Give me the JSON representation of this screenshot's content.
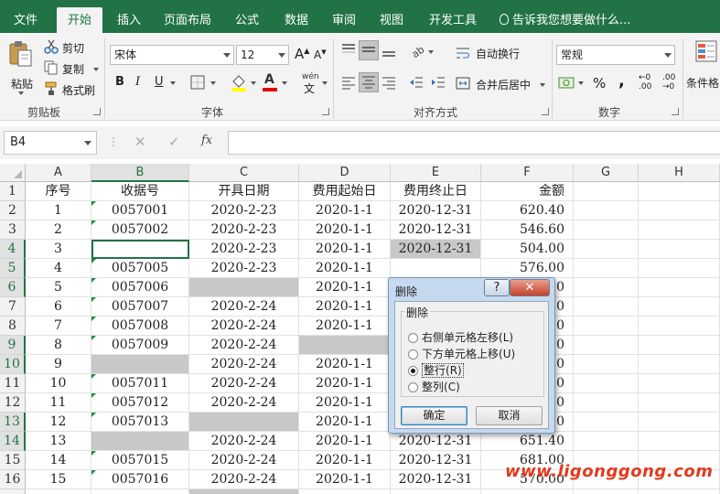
{
  "ribbon_tabs": [
    {
      "label": "文件"
    },
    {
      "label": "开始"
    },
    {
      "label": "插入"
    },
    {
      "label": "页面布局"
    },
    {
      "label": "公式"
    },
    {
      "label": "数据"
    },
    {
      "label": "审阅"
    },
    {
      "label": "视图"
    },
    {
      "label": "开发工具"
    }
  ],
  "active_tab": "开始",
  "tell_me": "告诉我您想要做什么...",
  "clipboard": {
    "paste": "粘贴",
    "cut": "剪切",
    "copy": "复制",
    "format_painter": "格式刷",
    "group_label": "剪贴板"
  },
  "font": {
    "name": "宋体",
    "size": "12",
    "grow": "A",
    "shrink": "A",
    "bold": "B",
    "italic": "I",
    "underline": "U",
    "wen": "wén",
    "group_label": "字体"
  },
  "alignment": {
    "wrap_text": "自动换行",
    "merge_center": "合并后居中",
    "group_label": "对齐方式"
  },
  "number": {
    "format": "常规",
    "percent": "%",
    "comma": ",",
    "inc_decimal": "←0 .00",
    "dec_decimal": ".00 →0",
    "group_label": "数字"
  },
  "styles": {
    "conditional_format": "条件格"
  },
  "formula_bar": {
    "name_box": "B4",
    "cancel": "✕",
    "enter": "✓",
    "fx": "fx",
    "content": ""
  },
  "columns": [
    "A",
    "B",
    "C",
    "D",
    "E",
    "F",
    "G",
    "H"
  ],
  "selected_column": "B",
  "rows": [
    {
      "n": "1",
      "a": "序号",
      "b": "收据号",
      "c": "开具日期",
      "d": "费用起始日",
      "e": "费用终止日",
      "f": "金额"
    },
    {
      "n": "2",
      "a": "1",
      "b": "0057001",
      "c": "2020-2-23",
      "d": "2020-1-1",
      "e": "2020-12-31",
      "f": "620.40"
    },
    {
      "n": "3",
      "a": "2",
      "b": "0057002",
      "c": "2020-2-23",
      "d": "2020-1-1",
      "e": "2020-12-31",
      "f": "546.60"
    },
    {
      "n": "4",
      "a": "3",
      "b": "",
      "c": "2020-2-23",
      "d": "2020-1-1",
      "e": "2020-12-31",
      "f": "504.00"
    },
    {
      "n": "5",
      "a": "4",
      "b": "0057005",
      "c": "2020-2-23",
      "d": "2020-1-1",
      "e": "",
      "f": "576.00"
    },
    {
      "n": "6",
      "a": "5",
      "b": "0057006",
      "c": "",
      "d": "2020-1-1",
      "e": "",
      "f": "0"
    },
    {
      "n": "7",
      "a": "6",
      "b": "0057007",
      "c": "2020-2-24",
      "d": "2020-1-1",
      "e": "",
      "f": "0"
    },
    {
      "n": "8",
      "a": "7",
      "b": "0057008",
      "c": "2020-2-24",
      "d": "2020-1-1",
      "e": "",
      "f": "0"
    },
    {
      "n": "9",
      "a": "8",
      "b": "0057009",
      "c": "2020-2-24",
      "d": "",
      "e": "",
      "f": "0"
    },
    {
      "n": "10",
      "a": "9",
      "b": "",
      "c": "2020-2-24",
      "d": "2020-1-1",
      "e": "",
      "f": "0"
    },
    {
      "n": "11",
      "a": "10",
      "b": "0057011",
      "c": "2020-2-24",
      "d": "2020-1-1",
      "e": "",
      "f": "0"
    },
    {
      "n": "12",
      "a": "11",
      "b": "0057012",
      "c": "2020-2-24",
      "d": "2020-1-1",
      "e": "",
      "f": "0"
    },
    {
      "n": "13",
      "a": "12",
      "b": "0057013",
      "c": "",
      "d": "2020-1-1",
      "e": "",
      "f": "0"
    },
    {
      "n": "14",
      "a": "13",
      "b": "",
      "c": "2020-2-24",
      "d": "2020-1-1",
      "e": "2020-12-31",
      "f": "651.40"
    },
    {
      "n": "15",
      "a": "14",
      "b": "0057015",
      "c": "2020-2-24",
      "d": "2020-1-1",
      "e": "2020-12-31",
      "f": "681.00"
    },
    {
      "n": "16",
      "a": "15",
      "b": "0057016",
      "c": "2020-2-24",
      "d": "2020-1-1",
      "e": "2020-12-31",
      "f": "570.00"
    }
  ],
  "selected_rows": [
    "4",
    "5",
    "6",
    "9",
    "10",
    "13",
    "14"
  ],
  "active_cell": "B4",
  "dialog": {
    "title": "删除",
    "help": "?",
    "close": "✕",
    "group_label": "删除",
    "options": [
      {
        "label": "右侧单元格左移",
        "key": "(L)"
      },
      {
        "label": "下方单元格上移",
        "key": "(U)"
      },
      {
        "label": "整行",
        "key": "(R)"
      },
      {
        "label": "整列",
        "key": "(C)"
      }
    ],
    "selected_option": "整行",
    "ok": "确定",
    "cancel": "取消"
  },
  "watermark": "www.ligonggong.com",
  "colors": {
    "accent": "#217346",
    "gray_fill": "#c8c8c8",
    "dialog_frame": "#c6d9ef",
    "watermark": "#e03a1e"
  }
}
